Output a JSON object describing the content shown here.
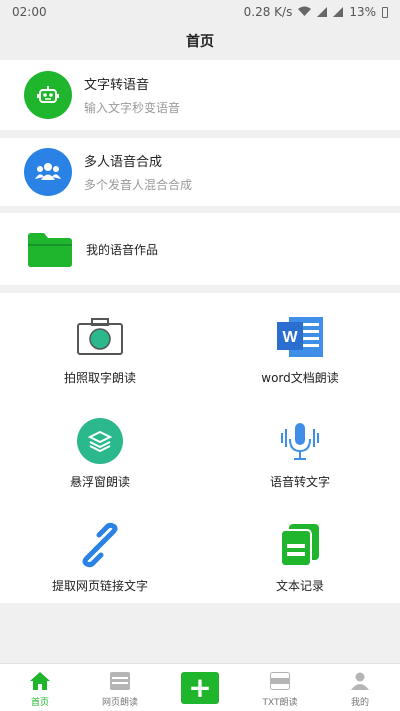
{
  "status_bar": {
    "time": "02:00",
    "network_speed": "0.28 K/s",
    "battery": "13%"
  },
  "header": {
    "title": "首页"
  },
  "cards": [
    {
      "title": "文字转语音",
      "subtitle": "输入文字秒变语音",
      "icon": "robot-icon",
      "color": "#1fb52d"
    },
    {
      "title": "多人语音合成",
      "subtitle": "多个发音人混合合成",
      "icon": "users-icon",
      "color": "#2a82e4"
    }
  ],
  "works": {
    "label": "我的语音作品",
    "icon": "folder-icon"
  },
  "features": [
    {
      "label": "拍照取字朗读",
      "icon": "camera-icon"
    },
    {
      "label": "word文档朗读",
      "icon": "word-document-icon"
    },
    {
      "label": "悬浮窗朗读",
      "icon": "layers-icon"
    },
    {
      "label": "语音转文字",
      "icon": "microphone-icon"
    },
    {
      "label": "提取网页链接文字",
      "icon": "link-icon"
    },
    {
      "label": "文本记录",
      "icon": "text-record-icon"
    }
  ],
  "tab_bar": {
    "tabs": [
      {
        "label": "首页",
        "icon": "home-icon",
        "active": true
      },
      {
        "label": "网页朗读",
        "icon": "web-icon",
        "active": false
      },
      {
        "label": "",
        "icon": "add-icon",
        "active": false
      },
      {
        "label": "TXT朗读",
        "icon": "txt-icon",
        "active": false
      },
      {
        "label": "我的",
        "icon": "user-icon",
        "active": false
      }
    ],
    "add_symbol": "+"
  },
  "colors": {
    "accent_green": "#1fb52d",
    "accent_blue": "#2a82e4",
    "background": "#f0f0f0"
  }
}
